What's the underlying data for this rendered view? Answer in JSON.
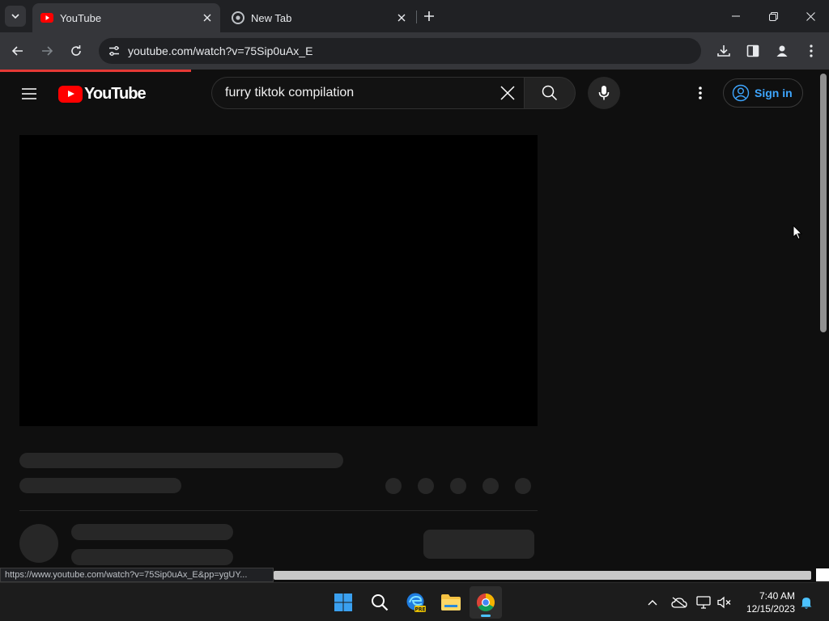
{
  "browser": {
    "tabs": [
      {
        "title": "YouTube",
        "active": true,
        "favicon": "youtube-favicon"
      },
      {
        "title": "New Tab",
        "active": false,
        "favicon": "chrome-favicon"
      }
    ],
    "url": "youtube.com/watch?v=75Sip0uAx_E",
    "status_url": "https://www.youtube.com/watch?v=75Sip0uAx_E&pp=ygUY...",
    "load_progress": 0.23
  },
  "youtube": {
    "logo_text": "YouTube",
    "search_query": "furry tiktok compilation",
    "sign_in_label": "Sign in",
    "colors": {
      "brand_red": "#ff0000",
      "link_blue": "#3ea6ff",
      "background": "#0f0f0f"
    }
  },
  "taskbar": {
    "apps": [
      "windows-start-icon",
      "search-icon",
      "edge-beta-icon",
      "file-explorer-icon",
      "chrome-icon"
    ],
    "time": "7:40 AM",
    "date": "12/15/2023"
  }
}
